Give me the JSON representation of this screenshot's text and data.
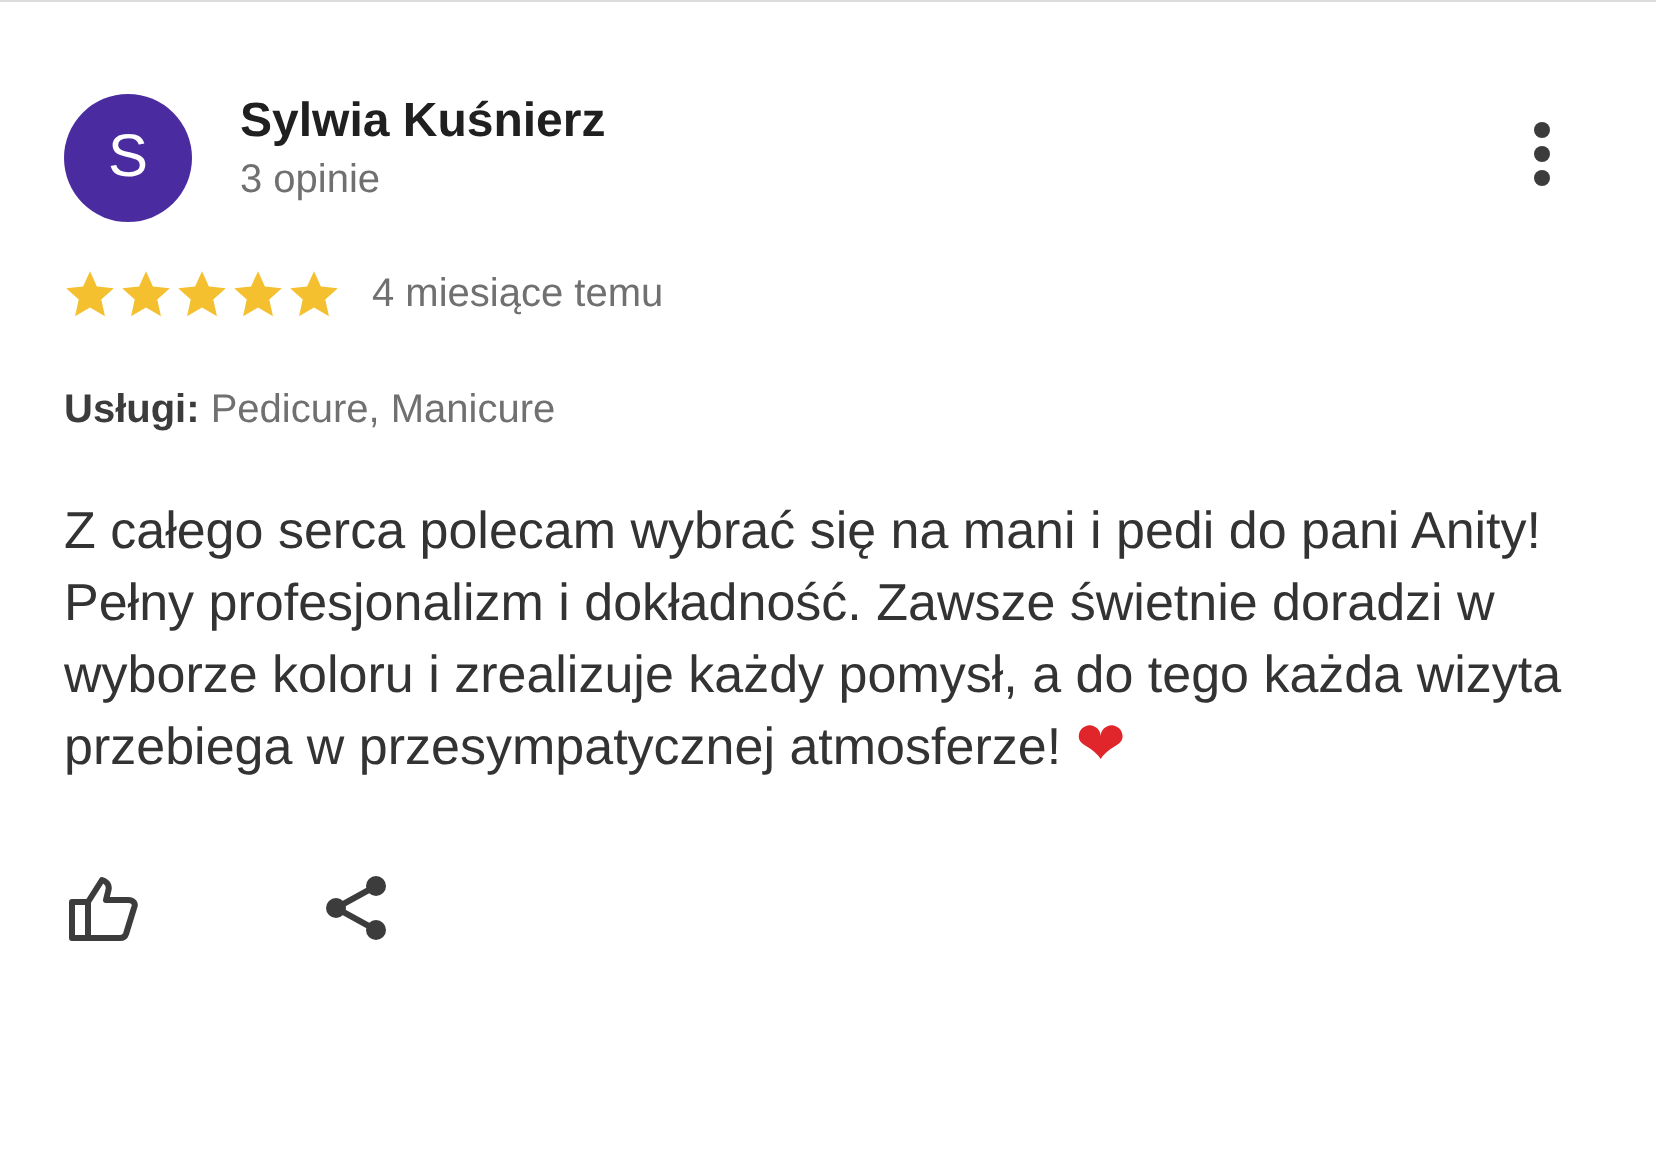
{
  "review": {
    "avatar_letter": "S",
    "author": "Sylwia Kuśnierz",
    "review_count": "3 opinie",
    "stars": 5,
    "time": "4 miesiące temu",
    "services_label": "Usługi:",
    "services": "Pedicure, Manicure",
    "text": "Z całego serca polecam wybrać się na mani i pedi do pani Anity! Pełny profesjonalizm i dokładność. Zawsze świetnie doradzi w wyborze koloru i zrealizuje każdy pomysł, a do tego każda wizyta przebiega w przesympatycznej atmosferze!",
    "emoji": "❤"
  }
}
